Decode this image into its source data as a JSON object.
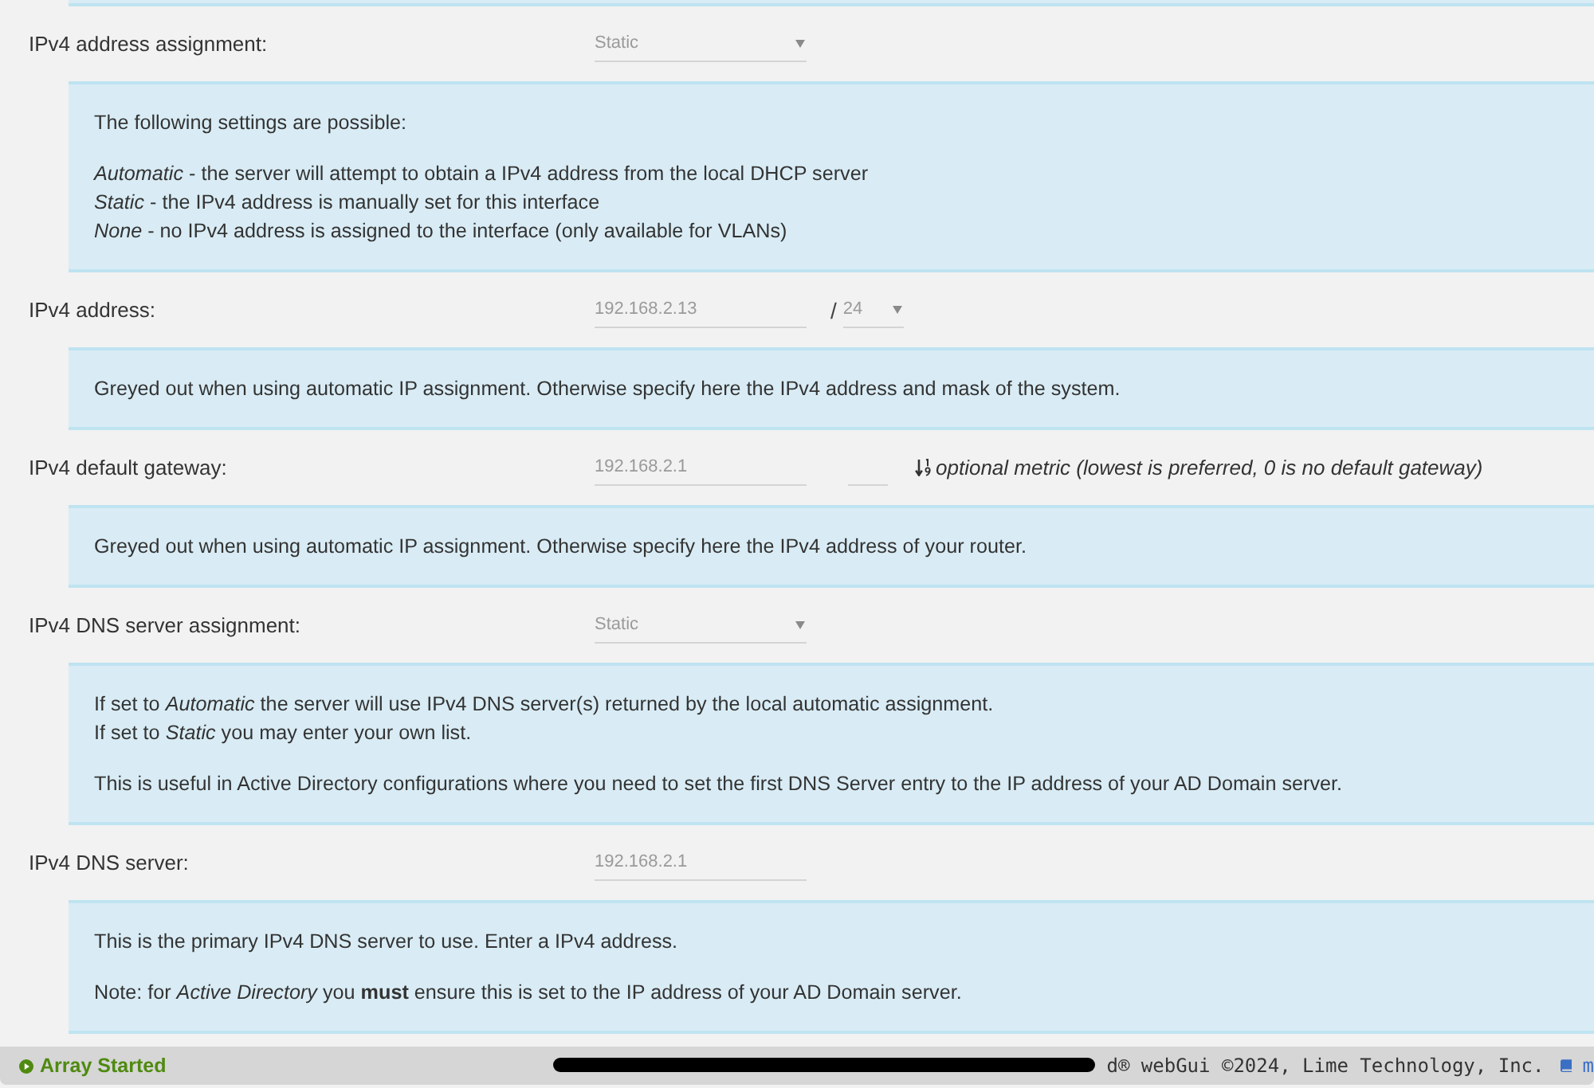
{
  "settings": [
    {
      "kind": "select",
      "label": "IPv4 address assignment:",
      "value": "Static",
      "help": [
        [
          "The following settings are possible:"
        ],
        [
          "*Automatic* - the server will attempt to obtain a IPv4 address from the local DHCP server",
          "*Static* - the IPv4 address is manually set for this interface",
          "*None* - no IPv4 address is assigned to the interface (only available for VLANs)"
        ]
      ]
    },
    {
      "kind": "address",
      "label": "IPv4 address:",
      "value": "192.168.2.13",
      "separator": "/",
      "mask": "24",
      "help": [
        [
          "Greyed out when using automatic IP assignment. Otherwise specify here the IPv4 address and mask of the system."
        ]
      ]
    },
    {
      "kind": "gateway",
      "label": "IPv4 default gateway:",
      "value": "192.168.2.1",
      "metric_hint": "optional metric (lowest is preferred, 0 is no default gateway)",
      "help": [
        [
          "Greyed out when using automatic IP assignment. Otherwise specify here the IPv4 address of your router."
        ]
      ]
    },
    {
      "kind": "select",
      "label": "IPv4 DNS server assignment:",
      "value": "Static",
      "help": [
        [
          "If set to *Automatic* the server will use IPv4 DNS server(s) returned by the local automatic assignment.",
          "If set to *Static* you may enter your own list."
        ],
        [
          "This is useful in Active Directory configurations where you need to set the first DNS Server entry to the IP address of your AD Domain server."
        ]
      ]
    },
    {
      "kind": "input",
      "label": "IPv4 DNS server:",
      "value": "192.168.2.1",
      "help": [
        [
          "This is the primary IPv4 DNS server to use. Enter a IPv4 address."
        ],
        [
          "Note: for *Active Directory* you **must** ensure this is set to the IP address of your AD Domain server."
        ]
      ]
    }
  ],
  "status_bar": {
    "array_status": "Array Started",
    "copyright": "d® webGui ©2024, Lime Technology, Inc.",
    "manual_link": "m"
  }
}
